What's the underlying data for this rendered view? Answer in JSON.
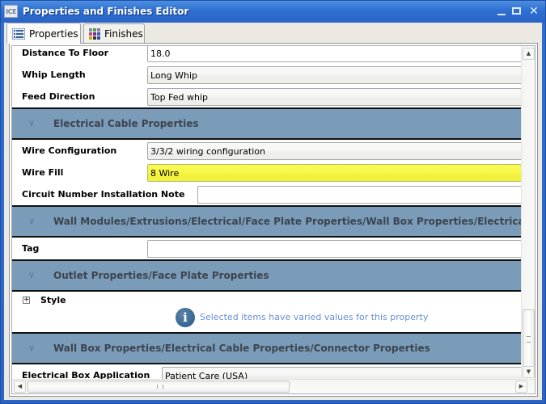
{
  "window": {
    "app_icon_text": "ICE",
    "title": "Properties and Finishes Editor",
    "controls": {
      "minimize": "_",
      "maximize": "□",
      "close": "✕"
    }
  },
  "tabs": [
    {
      "label": "Properties",
      "icon": "list-icon",
      "active": true
    },
    {
      "label": "Finishes",
      "icon": "color-grid-icon",
      "active": false
    }
  ],
  "rows_top": [
    {
      "label": "Distance To Floor",
      "value": "18.0",
      "style": "plain"
    },
    {
      "label": "Whip Length",
      "value": "Long Whip",
      "style": "dropdown"
    },
    {
      "label": "Feed Direction",
      "value": "Top Fed whip",
      "style": "dropdown"
    }
  ],
  "sections": [
    {
      "title": "Electrical Cable Properties",
      "rows": [
        {
          "label": "Wire Configuration",
          "value": "3/3/2 wiring configuration",
          "style": "dropdown"
        },
        {
          "label": "Wire Fill",
          "value": "8 Wire",
          "style": "highlight"
        },
        {
          "label": "Circuit Number Installation Note",
          "value": "",
          "style": "plain"
        }
      ]
    },
    {
      "title": "Wall Modules/Extrusions/Electrical/Face Plate Properties/Wall Box Properties/Electrical Cable Properties",
      "rows": [
        {
          "label": "Tag",
          "value": "",
          "style": "plain"
        }
      ]
    },
    {
      "title": "Outlet Properties/Face Plate Properties",
      "style_group": {
        "label": "Style",
        "expand_symbol": "+",
        "info_icon": "i",
        "info_text": "Selected items have varied values for this property"
      }
    },
    {
      "title": "Wall Box Properties/Electrical Cable Properties/Connector Properties",
      "rows": [
        {
          "label": "Electrical Box Application",
          "value": "Patient Care (USA)",
          "style": "dropdown"
        }
      ]
    }
  ],
  "colors": {
    "section_header": "#7a9cb8",
    "highlight_field": "#f9f94f",
    "info_text": "#6a8fd2",
    "title_bar": "#2e6fd2"
  },
  "scrollbars": {
    "vertical_position": 0.92,
    "horizontal_position": 0.0,
    "up_arrow": "▲",
    "down_arrow": "▼",
    "left_arrow": "◀",
    "right_arrow": "▶"
  }
}
